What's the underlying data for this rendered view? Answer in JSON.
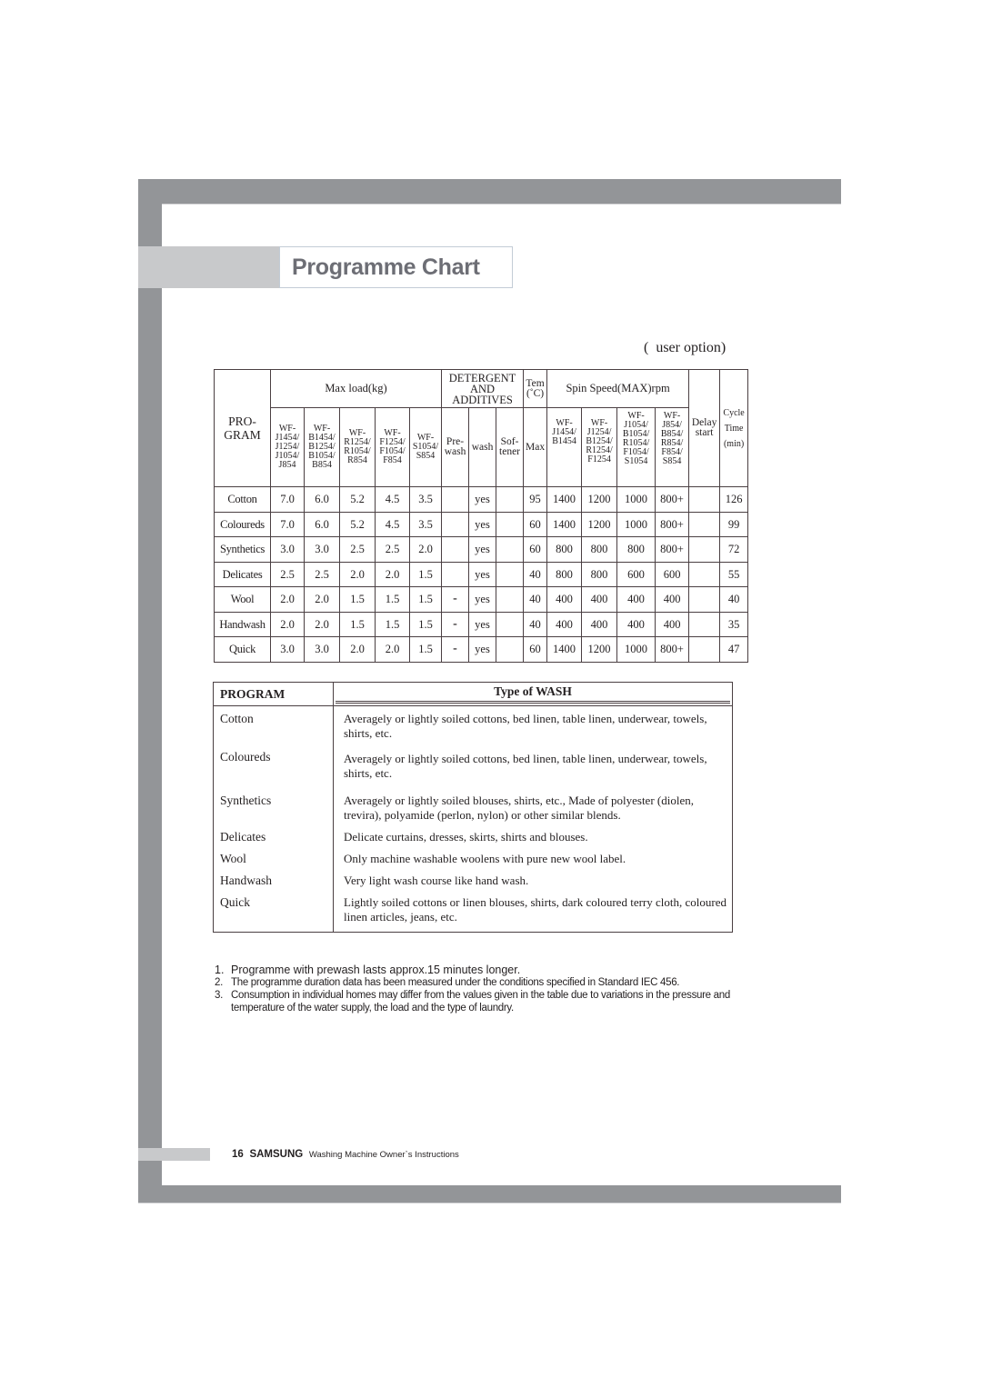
{
  "header": {
    "title": "Programme Chart",
    "user_option": "(  user option)"
  },
  "program_table": {
    "headers": {
      "program": "PRO-\nGRAM",
      "max_load": "Max load(kg)",
      "detergent": "DETERGENT\nAND\nADDITIVES",
      "temp": "Tem\n(˚C)",
      "spin_speed": "Spin Speed(MAX)rpm",
      "delay_start": "Delay\nstart",
      "cycle_time": "Cycle\nTime\n(min)",
      "load_models": [
        "WF-\nJ1454/\nJ1254/\nJ1054/\nJ854",
        "WF-\nB1454/\nB1254/\nB1054/\nB854",
        "WF-\nR1254/\nR1054/\nR854",
        "WF-\nF1254/\nF1054/\nF854",
        "WF-\nS1054/\nS854"
      ],
      "prewash": "Pre-\nwash",
      "wash": "wash",
      "softener": "Sof-\ntener",
      "temp_max": "Max",
      "spin_models": [
        "WF-\nJ1454/\nB1454",
        "WF-\nJ1254/\nB1254/\nR1254/\nF1254",
        "WF-\nJ1054/\nB1054/\nR1054/\nF1054/\nS1054",
        "WF-\nJ854/\nB854/\nR854/\nF854/\nS854"
      ]
    },
    "rows": [
      {
        "program": "Cotton",
        "loads": [
          "7.0",
          "6.0",
          "5.2",
          "4.5",
          "3.5"
        ],
        "prewash": "",
        "wash": "yes",
        "softener": "",
        "temp": "95",
        "spin": [
          "1400",
          "1200",
          "1000",
          "800+"
        ],
        "delay": "",
        "cycle": "126"
      },
      {
        "program": "Coloureds",
        "loads": [
          "7.0",
          "6.0",
          "5.2",
          "4.5",
          "3.5"
        ],
        "prewash": "",
        "wash": "yes",
        "softener": "",
        "temp": "60",
        "spin": [
          "1400",
          "1200",
          "1000",
          "800+"
        ],
        "delay": "",
        "cycle": "99"
      },
      {
        "program": "Synthetics",
        "loads": [
          "3.0",
          "3.0",
          "2.5",
          "2.5",
          "2.0"
        ],
        "prewash": "",
        "wash": "yes",
        "softener": "",
        "temp": "60",
        "spin": [
          "800",
          "800",
          "800",
          "800+"
        ],
        "delay": "",
        "cycle": "72"
      },
      {
        "program": "Delicates",
        "loads": [
          "2.5",
          "2.5",
          "2.0",
          "2.0",
          "1.5"
        ],
        "prewash": "",
        "wash": "yes",
        "softener": "",
        "temp": "40",
        "spin": [
          "800",
          "800",
          "600",
          "600"
        ],
        "delay": "",
        "cycle": "55"
      },
      {
        "program": "Wool",
        "loads": [
          "2.0",
          "2.0",
          "1.5",
          "1.5",
          "1.5"
        ],
        "prewash": "-",
        "wash": "yes",
        "softener": "",
        "temp": "40",
        "spin": [
          "400",
          "400",
          "400",
          "400"
        ],
        "delay": "",
        "cycle": "40"
      },
      {
        "program": "Handwash",
        "loads": [
          "2.0",
          "2.0",
          "1.5",
          "1.5",
          "1.5"
        ],
        "prewash": "-",
        "wash": "yes",
        "softener": "",
        "temp": "40",
        "spin": [
          "400",
          "400",
          "400",
          "400"
        ],
        "delay": "",
        "cycle": "35"
      },
      {
        "program": "Quick",
        "loads": [
          "3.0",
          "3.0",
          "2.0",
          "2.0",
          "1.5"
        ],
        "prewash": "-",
        "wash": "yes",
        "softener": "",
        "temp": "60",
        "spin": [
          "1400",
          "1200",
          "1000",
          "800+"
        ],
        "delay": "",
        "cycle": "47"
      }
    ]
  },
  "wash_table": {
    "headers": {
      "program": "PROGRAM",
      "type": "Type of  WASH"
    },
    "rows": [
      {
        "program": "Cotton",
        "description": "Averagely or lightly soiled cottons, bed linen, table linen, underwear, towels, shirts, etc."
      },
      {
        "program": "Coloureds",
        "description": "Averagely or lightly soiled cottons, bed linen, table linen, underwear, towels, shirts, etc."
      },
      {
        "program": "Synthetics",
        "description": "Averagely or lightly soiled blouses, shirts, etc., Made of polyester (diolen, trevira), polyamide (perlon, nylon) or other similar blends."
      },
      {
        "program": "Delicates",
        "description": "Delicate curtains, dresses, skirts, shirts and blouses."
      },
      {
        "program": "Wool",
        "description": "Only machine washable woolens with pure new wool label."
      },
      {
        "program": "Handwash",
        "description": "Very light wash course like hand wash."
      },
      {
        "program": "Quick",
        "description": "Lightly soiled cottons or linen blouses, shirts, dark coloured terry cloth, coloured linen articles, jeans, etc."
      }
    ]
  },
  "notes": [
    {
      "num": "1.",
      "text": "Programme with prewash lasts approx.15 minutes longer."
    },
    {
      "num": "2.",
      "text": "The programme duration data has been measured under the conditions specified in Standard IEC 456."
    },
    {
      "num": "3.",
      "text": "Consumption in individual homes may differ from the values given in the table due to variations in the pressure and temperature of the water supply, the load and the type of laundry."
    }
  ],
  "footer": {
    "page_number": "16",
    "brand": "SAMSUNG",
    "text": "Washing Machine Owner`s Instructions"
  },
  "colors": {
    "frame": "#939598",
    "frame_light": "#c8c9cb",
    "title_text": "#6d6e75"
  }
}
